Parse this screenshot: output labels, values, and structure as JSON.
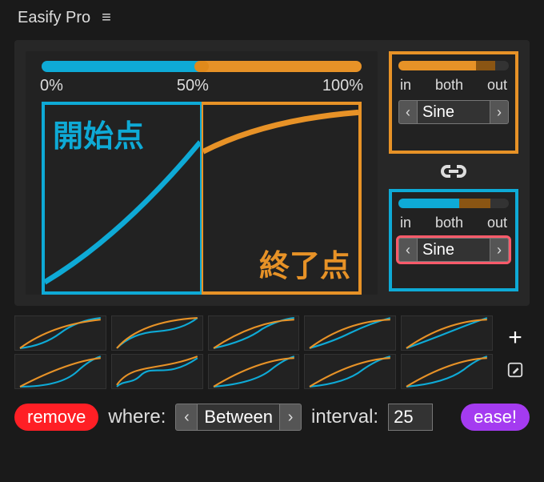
{
  "app": {
    "title": "Easify Pro"
  },
  "main_slider": {
    "labels": [
      "0%",
      "50%",
      "100%"
    ]
  },
  "graph": {
    "start_label": "開始点",
    "end_label": "終了点"
  },
  "ease_boxes": {
    "top": {
      "in_label": "in",
      "both_label": "both",
      "out_label": "out",
      "curve": "Sine"
    },
    "bottom": {
      "in_label": "in",
      "both_label": "both",
      "out_label": "out",
      "curve": "Sine"
    }
  },
  "bottom_bar": {
    "remove_label": "remove",
    "where_label": "where:",
    "where_value": "Between",
    "interval_label": "interval:",
    "interval_value": "25",
    "ease_label": "ease!"
  },
  "colors": {
    "blue": "#0eaad6",
    "orange": "#e79227"
  }
}
